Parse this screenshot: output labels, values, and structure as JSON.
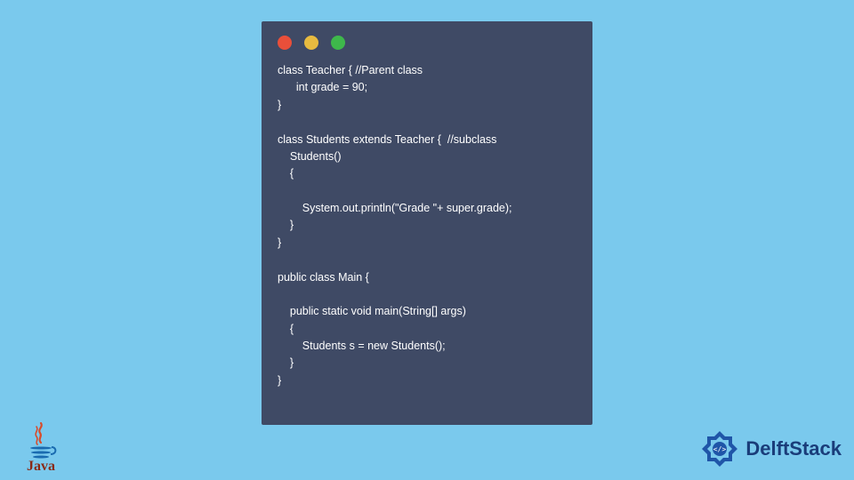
{
  "code_window": {
    "lines": "class Teacher { //Parent class\n      int grade = 90;\n}\n\nclass Students extends Teacher {  //subclass\n    Students()\n    {\n\n        System.out.println(\"Grade \"+ super.grade);\n    }\n}\n\npublic class Main {\n\n    public static void main(String[] args)\n    {\n        Students s = new Students();\n    }\n}"
  },
  "java": {
    "label": "Java"
  },
  "delft": {
    "brand": "DelftStack"
  }
}
